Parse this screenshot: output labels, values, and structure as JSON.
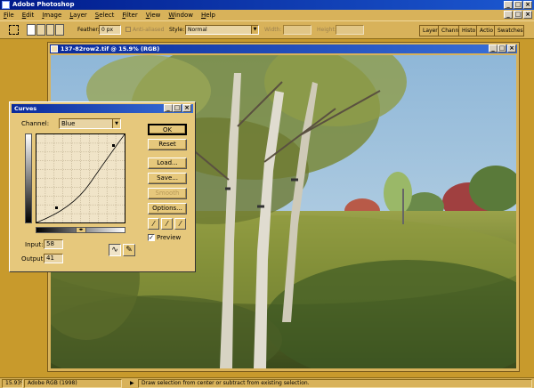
{
  "app": {
    "title": "Adobe Photoshop",
    "menu": [
      "File",
      "Edit",
      "Image",
      "Layer",
      "Select",
      "Filter",
      "View",
      "Window",
      "Help"
    ]
  },
  "options": {
    "feather_label": "Feather:",
    "feather_value": "0 px",
    "antialiased_label": "Anti-aliased",
    "style_label": "Style:",
    "style_value": "Normal",
    "width_label": "Width:",
    "height_label": "Height:"
  },
  "palette_tabs": [
    "Layer",
    "Channe",
    "Histo",
    "Actio",
    "Swatches"
  ],
  "document": {
    "title": "137-82row2.tif @ 15.9% (RGB)"
  },
  "curves": {
    "title": "Curves",
    "channel_label": "Channel:",
    "channel_value": "Blue",
    "buttons": {
      "ok": "OK",
      "reset": "Reset",
      "load": "Load...",
      "save": "Save...",
      "smooth": "Smooth",
      "options": "Options..."
    },
    "input_label": "Input:",
    "input_value": "58",
    "output_label": "Output:",
    "output_value": "41",
    "preview_label": "Preview",
    "preview_checked": true
  },
  "status": {
    "zoom": "15.93%",
    "profile": "Adobe RGB (1998)",
    "hint": "Draw selection from center or subtract from existing selection."
  },
  "colors": {
    "workspace": "#c89a2c",
    "chrome": "#d8b25a",
    "dialog": "#e6c87c",
    "titlebar": "#0a2a9a"
  }
}
